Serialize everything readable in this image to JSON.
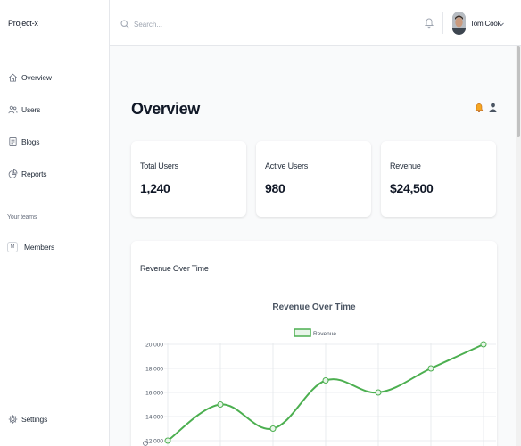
{
  "app": {
    "brand": "Project-x"
  },
  "sidebar": {
    "items": [
      {
        "label": "Overview",
        "icon": "home-icon"
      },
      {
        "label": "Users",
        "icon": "users-icon"
      },
      {
        "label": "Blogs",
        "icon": "document-icon"
      },
      {
        "label": "Reports",
        "icon": "pie-chart-icon"
      }
    ],
    "teams_title": "Your teams",
    "teams": [
      {
        "badge": "M",
        "label": "Members"
      }
    ],
    "settings_label": "Settings"
  },
  "topbar": {
    "search_placeholder": "Search...",
    "user_name": "Tom Cook"
  },
  "main": {
    "title": "Overview",
    "cards": [
      {
        "label": "Total Users",
        "value": "1,240"
      },
      {
        "label": "Active Users",
        "value": "980"
      },
      {
        "label": "Revenue",
        "value": "$24,500"
      }
    ],
    "panel_title": "Revenue Over Time"
  },
  "colors": {
    "accent": "#4caf50",
    "bell": "#f59e0b"
  },
  "chart_data": {
    "type": "line",
    "title": "Revenue Over Time",
    "series": [
      {
        "name": "Revenue",
        "values": [
          12000,
          15000,
          13000,
          17000,
          16000,
          18000,
          20000
        ]
      }
    ],
    "y_ticks": [
      "20,000",
      "18,000",
      "16,000",
      "14,000",
      "12,000"
    ],
    "ylim": [
      12000,
      20000
    ],
    "grid": true,
    "legend": "top-center"
  }
}
